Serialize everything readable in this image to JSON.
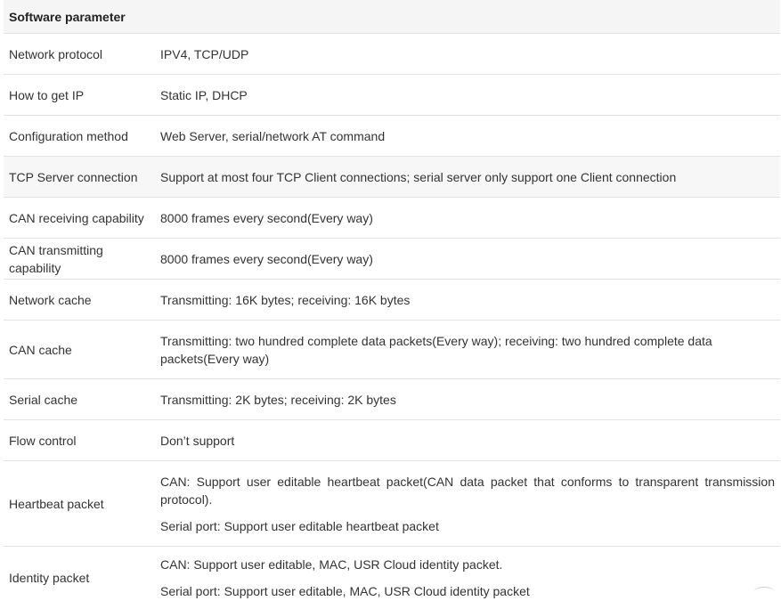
{
  "table": {
    "header": "Software parameter",
    "rows": [
      {
        "label": "Network protocol",
        "value": [
          "IPV4, TCP/UDP"
        ]
      },
      {
        "label": "How to get IP",
        "value": [
          "Static IP, DHCP"
        ]
      },
      {
        "label": "Configuration method",
        "value": [
          "Web Server, serial/network AT command"
        ]
      },
      {
        "label": "TCP Server connection",
        "value": [
          "Support at most four TCP Client connections; serial server only support one  Client connection"
        ]
      },
      {
        "label": "CAN receiving capability",
        "value": [
          "8000 frames every second(Every way)"
        ]
      },
      {
        "label": "CAN transmitting capability",
        "value": [
          "8000 frames every second(Every way)"
        ]
      },
      {
        "label": "Network cache",
        "value": [
          "Transmitting: 16K bytes; receiving: 16K bytes"
        ]
      },
      {
        "label": "CAN cache",
        "value": [
          "Transmitting: two hundred complete data packets(Every way); receiving: two hundred complete data packets(Every way)"
        ]
      },
      {
        "label": "Serial cache",
        "value": [
          "Transmitting: 2K bytes; receiving: 2K bytes"
        ]
      },
      {
        "label": "Flow control",
        "value": [
          "Don’t support"
        ]
      },
      {
        "label": "Heartbeat packet",
        "value": [
          "CAN: Support user editable heartbeat packet(CAN data packet that conforms to transparent transmission protocol).",
          "Serial port: Support user editable heartbeat packet"
        ]
      },
      {
        "label": "Identity packet",
        "value": [
          "CAN: Support user editable, MAC, USR Cloud identity packet.",
          "Serial port: Support user editable, MAC, USR Cloud identity packet"
        ]
      }
    ]
  }
}
